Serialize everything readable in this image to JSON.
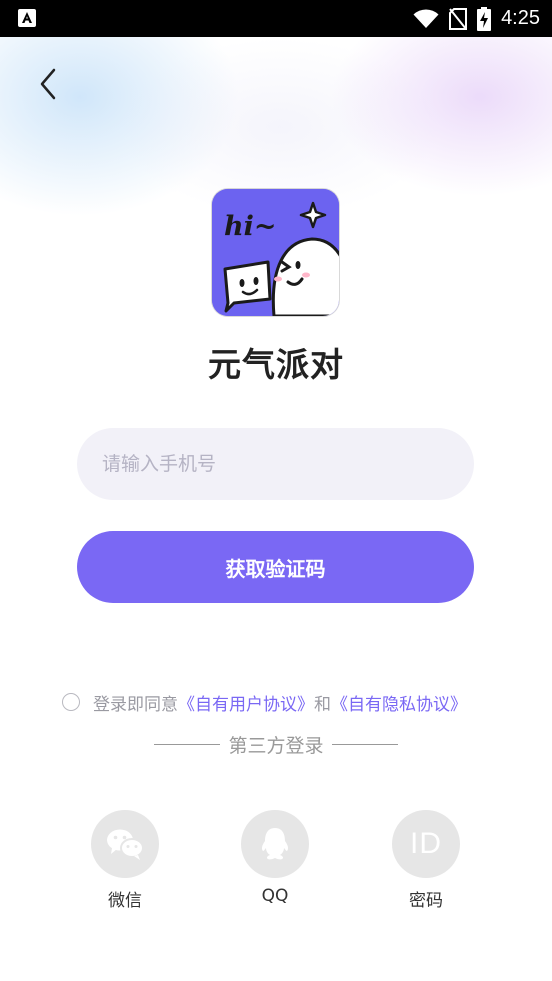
{
  "status_bar": {
    "time": "4:25"
  },
  "app": {
    "name": "元气派对",
    "logo_text": "hi~"
  },
  "form": {
    "phone_placeholder": "请输入手机号",
    "get_code_label": "获取验证码"
  },
  "agreement": {
    "prefix": "登录即同意",
    "user_agreement": "《自有用户协议》",
    "conjunction": "和",
    "privacy_agreement": "《自有隐私协议》"
  },
  "third_party": {
    "title": "第三方登录",
    "options": [
      {
        "label": "微信",
        "icon": "wechat-icon"
      },
      {
        "label": "QQ",
        "icon": "qq-icon"
      },
      {
        "label": "密码",
        "icon": "id-icon",
        "icon_text": "ID"
      }
    ]
  },
  "colors": {
    "accent": "#7a68f4",
    "logo_bg": "#6c63f0"
  }
}
